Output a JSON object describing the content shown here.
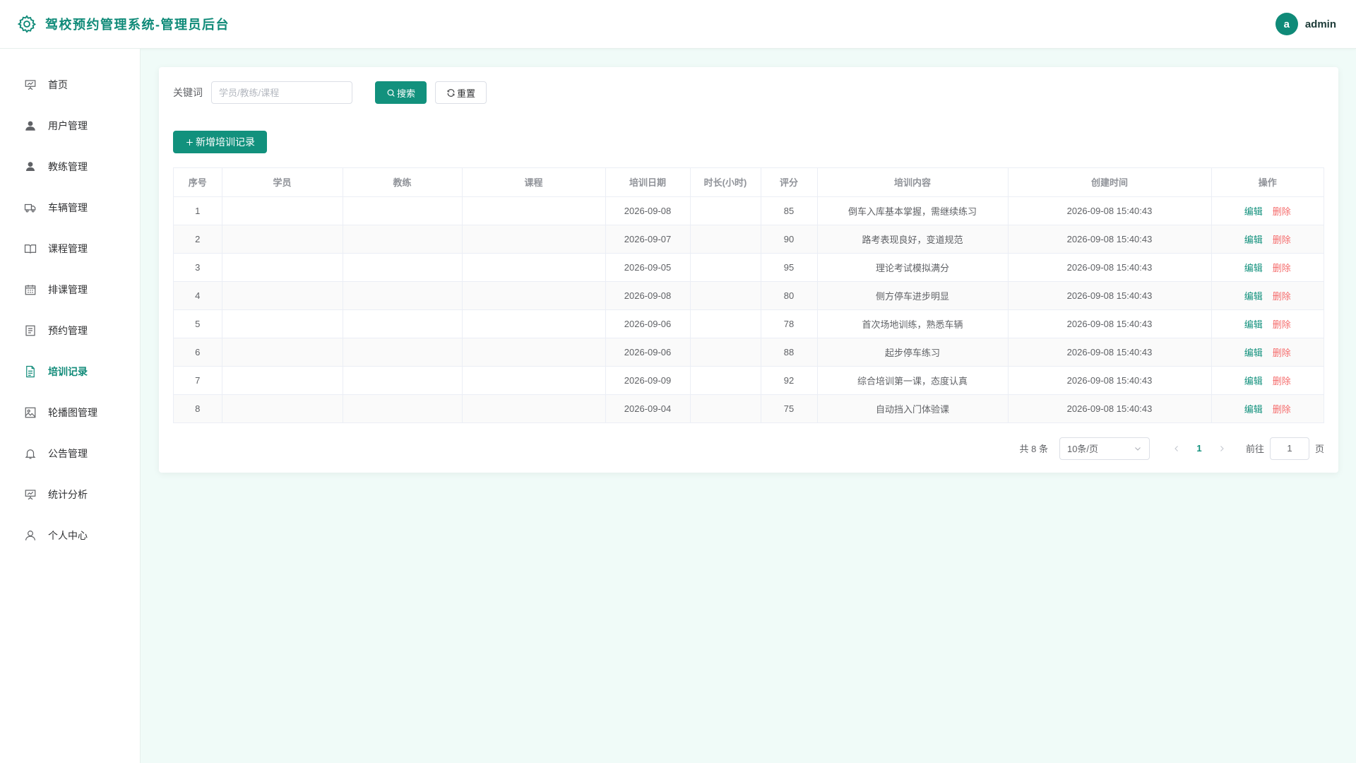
{
  "header": {
    "title": "驾校预约管理系统-管理员后台",
    "avatar_letter": "a",
    "user_name": "admin"
  },
  "sidebar": {
    "items": [
      {
        "label": "首页",
        "icon": "presentation-icon"
      },
      {
        "label": "用户管理",
        "icon": "user-filled-icon"
      },
      {
        "label": "教练管理",
        "icon": "avatar-icon"
      },
      {
        "label": "车辆管理",
        "icon": "van-icon"
      },
      {
        "label": "课程管理",
        "icon": "book-icon"
      },
      {
        "label": "排课管理",
        "icon": "calendar-icon"
      },
      {
        "label": "预约管理",
        "icon": "tickets-icon"
      },
      {
        "label": "培训记录",
        "icon": "document-icon",
        "active": true
      },
      {
        "label": "轮播图管理",
        "icon": "picture-icon"
      },
      {
        "label": "公告管理",
        "icon": "bell-icon"
      },
      {
        "label": "统计分析",
        "icon": "data-board-icon"
      },
      {
        "label": "个人中心",
        "icon": "user-icon"
      }
    ]
  },
  "filter": {
    "keyword_label": "关键词",
    "keyword_placeholder": "学员/教练/课程",
    "keyword_value": "",
    "search_label": "搜索",
    "reset_label": "重置"
  },
  "toolbar": {
    "add_label": "新增培训记录"
  },
  "table": {
    "columns": [
      "序号",
      "学员",
      "教练",
      "课程",
      "培训日期",
      "时长(小时)",
      "评分",
      "培训内容",
      "创建时间",
      "操作"
    ],
    "edit_label": "编辑",
    "delete_label": "删除",
    "rows": [
      {
        "no": "1",
        "student": "",
        "coach": "",
        "course": "",
        "date": "2026-09-08",
        "hours": "",
        "score": "85",
        "content": "倒车入库基本掌握，需继续练习",
        "created": "2026-09-08 15:40:43"
      },
      {
        "no": "2",
        "student": "",
        "coach": "",
        "course": "",
        "date": "2026-09-07",
        "hours": "",
        "score": "90",
        "content": "路考表现良好，变道规范",
        "created": "2026-09-08 15:40:43"
      },
      {
        "no": "3",
        "student": "",
        "coach": "",
        "course": "",
        "date": "2026-09-05",
        "hours": "",
        "score": "95",
        "content": "理论考试模拟满分",
        "created": "2026-09-08 15:40:43"
      },
      {
        "no": "4",
        "student": "",
        "coach": "",
        "course": "",
        "date": "2026-09-08",
        "hours": "",
        "score": "80",
        "content": "侧方停车进步明显",
        "created": "2026-09-08 15:40:43"
      },
      {
        "no": "5",
        "student": "",
        "coach": "",
        "course": "",
        "date": "2026-09-06",
        "hours": "",
        "score": "78",
        "content": "首次场地训练，熟悉车辆",
        "created": "2026-09-08 15:40:43"
      },
      {
        "no": "6",
        "student": "",
        "coach": "",
        "course": "",
        "date": "2026-09-06",
        "hours": "",
        "score": "88",
        "content": "起步停车练习",
        "created": "2026-09-08 15:40:43"
      },
      {
        "no": "7",
        "student": "",
        "coach": "",
        "course": "",
        "date": "2026-09-09",
        "hours": "",
        "score": "92",
        "content": "综合培训第一课，态度认真",
        "created": "2026-09-08 15:40:43"
      },
      {
        "no": "8",
        "student": "",
        "coach": "",
        "course": "",
        "date": "2026-09-04",
        "hours": "",
        "score": "75",
        "content": "自动挡入门体验课",
        "created": "2026-09-08 15:40:43"
      }
    ]
  },
  "pagination": {
    "total_text": "共 8 条",
    "page_size": "10条/页",
    "current_page": "1",
    "goto_prefix": "前往",
    "goto_value": "1",
    "goto_suffix": "页"
  },
  "colors": {
    "primary": "#12917d",
    "danger": "#f56c6c",
    "background": "#f0fbf8"
  }
}
